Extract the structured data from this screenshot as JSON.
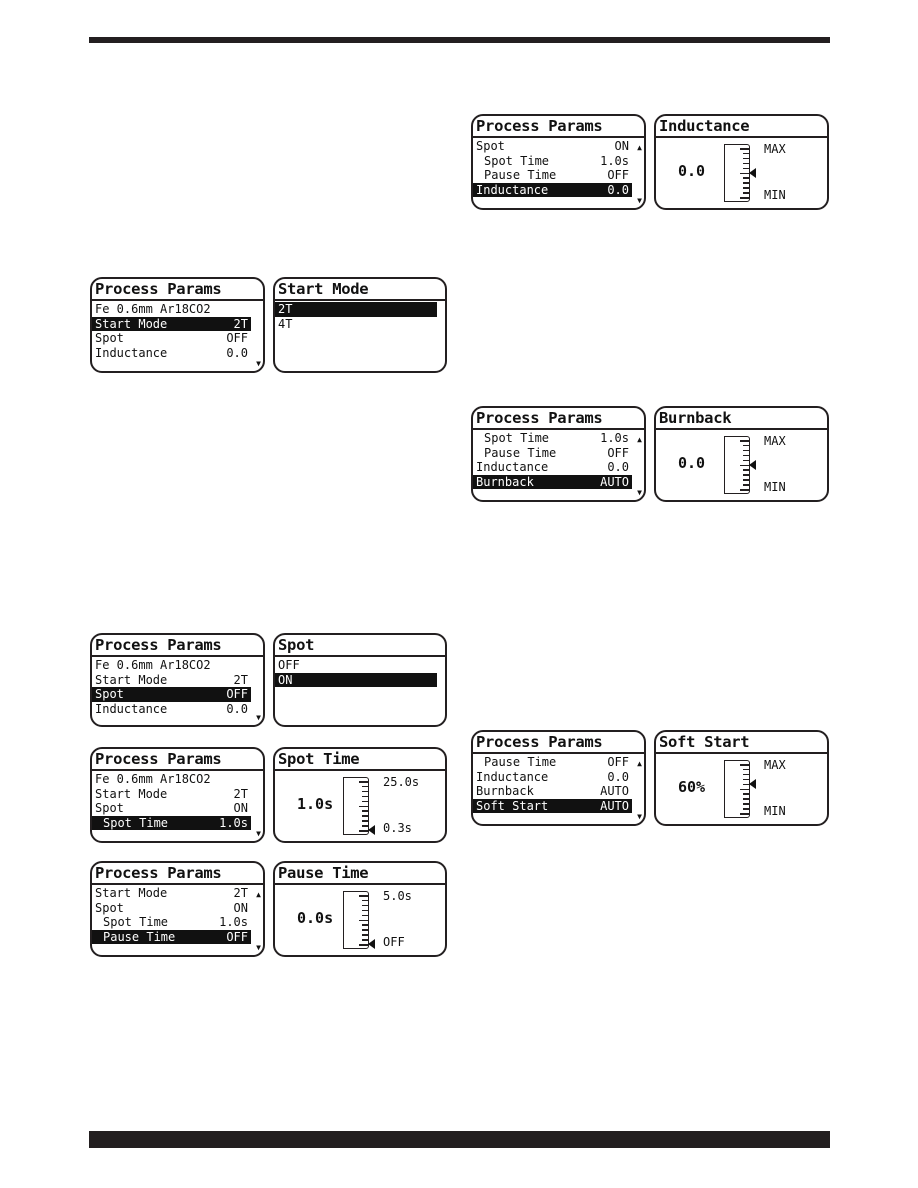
{
  "page": {
    "header_bar": "top rule",
    "footer_bar": "bottom rule"
  },
  "screens": {
    "start_mode_menu": {
      "title": "Process Params",
      "rows": [
        {
          "label": "Fe 0.6mm Ar18CO2",
          "value": ""
        },
        {
          "label": "Start Mode",
          "value": "2T"
        },
        {
          "label": "Spot",
          "value": "OFF"
        },
        {
          "label": "Inductance",
          "value": "0.0"
        }
      ],
      "selected_index": 1
    },
    "start_mode_select": {
      "title": "Start Mode",
      "options": [
        "2T",
        "4T"
      ],
      "selected_index": 0
    },
    "spot_menu": {
      "title": "Process Params",
      "rows": [
        {
          "label": "Fe 0.6mm Ar18CO2",
          "value": ""
        },
        {
          "label": "Start Mode",
          "value": "2T"
        },
        {
          "label": "Spot",
          "value": "OFF"
        },
        {
          "label": "Inductance",
          "value": "0.0"
        }
      ],
      "selected_index": 2
    },
    "spot_select": {
      "title": "Spot",
      "options": [
        "OFF",
        "ON"
      ],
      "selected_index": 1
    },
    "spot_time_menu": {
      "title": "Process Params",
      "rows": [
        {
          "label": "Fe 0.6mm Ar18CO2",
          "value": ""
        },
        {
          "label": "Start Mode",
          "value": "2T"
        },
        {
          "label": "Spot",
          "value": "ON"
        },
        {
          "label": "Spot Time",
          "value": "1.0s"
        }
      ],
      "selected_index": 3
    },
    "spot_time_gauge": {
      "title": "Spot Time",
      "value": "1.0s",
      "max_label": "25.0s",
      "min_label": "0.3s",
      "level": 0.0
    },
    "pause_time_menu": {
      "title": "Process Params",
      "rows": [
        {
          "label": "Start Mode",
          "value": "2T"
        },
        {
          "label": "Spot",
          "value": "ON"
        },
        {
          "label": "Spot Time",
          "value": "1.0s"
        },
        {
          "label": "Pause Time",
          "value": "OFF"
        }
      ],
      "selected_index": 3
    },
    "pause_time_gauge": {
      "title": "Pause Time",
      "value": "0.0s",
      "max_label": "5.0s",
      "min_label": "OFF",
      "level": 0.0
    },
    "inductance_menu": {
      "title": "Process Params",
      "rows": [
        {
          "label": "Spot",
          "value": "ON"
        },
        {
          "label": "Spot Time",
          "value": "1.0s"
        },
        {
          "label": "Pause Time",
          "value": "OFF"
        },
        {
          "label": "Inductance",
          "value": "0.0"
        }
      ],
      "selected_index": 3
    },
    "inductance_gauge": {
      "title": "Inductance",
      "value": "0.0",
      "max_label": "MAX",
      "min_label": "MIN",
      "level": 0.5
    },
    "burnback_menu": {
      "title": "Process Params",
      "rows": [
        {
          "label": "Spot Time",
          "value": "1.0s"
        },
        {
          "label": "Pause Time",
          "value": "OFF"
        },
        {
          "label": "Inductance",
          "value": "0.0"
        },
        {
          "label": "Burnback",
          "value": "AUTO"
        }
      ],
      "selected_index": 3
    },
    "burnback_gauge": {
      "title": "Burnback",
      "value": "0.0",
      "max_label": "MAX",
      "min_label": "MIN",
      "level": 0.5
    },
    "soft_start_menu": {
      "title": "Process Params",
      "rows": [
        {
          "label": "Pause Time",
          "value": "OFF"
        },
        {
          "label": "Inductance",
          "value": "0.0"
        },
        {
          "label": "Burnback",
          "value": "AUTO"
        },
        {
          "label": "Soft Start",
          "value": "AUTO"
        }
      ],
      "selected_index": 3
    },
    "soft_start_gauge": {
      "title": "Soft Start",
      "value": "60%",
      "max_label": "MAX",
      "min_label": "MIN",
      "level": 0.6
    }
  },
  "icons": {
    "scroll_up": "▲",
    "scroll_down": "▼"
  }
}
